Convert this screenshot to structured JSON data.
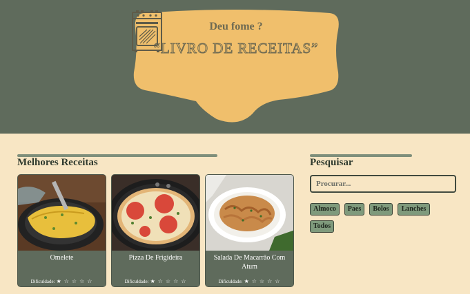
{
  "header": {
    "question": "Deu fome ?",
    "title": "“LIVRO  DE RECEITAS”",
    "logo_icon": "stove-oven-icon"
  },
  "best_recipes": {
    "heading": "Melhores Receitas",
    "difficulty_label": "Dificuldade:",
    "cards": [
      {
        "name": "Omelete",
        "image": "omelete-photo",
        "stars": "★ ☆ ☆ ☆ ☆"
      },
      {
        "name": "Pizza De Frigideira",
        "image": "pizza-photo",
        "stars": "★ ☆ ☆ ☆ ☆"
      },
      {
        "name": "Salada De Macarrão Com Atum",
        "image": "pasta-salad-photo",
        "stars": "★ ☆ ☆ ☆ ☆"
      }
    ]
  },
  "search": {
    "heading": "Pesquisar",
    "placeholder": "Procurar...",
    "tags": [
      "Almoco",
      "Paes",
      "Bolos",
      "Lanches",
      "Todos"
    ]
  },
  "colors": {
    "header_bg": "#5f6b5c",
    "page_bg": "#f8e6c4",
    "banner": "#f0bf6c",
    "tag_bg": "#7f9a7c"
  }
}
